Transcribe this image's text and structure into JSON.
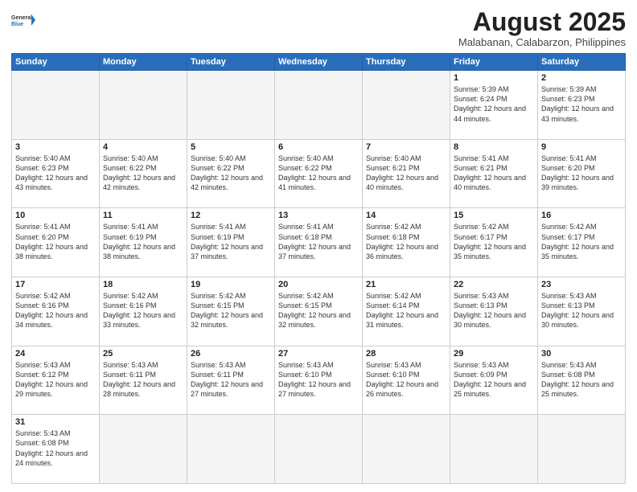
{
  "header": {
    "logo_general": "General",
    "logo_blue": "Blue",
    "title": "August 2025",
    "subtitle": "Malabanan, Calabarzon, Philippines"
  },
  "weekdays": [
    "Sunday",
    "Monday",
    "Tuesday",
    "Wednesday",
    "Thursday",
    "Friday",
    "Saturday"
  ],
  "weeks": [
    [
      {
        "day": "",
        "info": ""
      },
      {
        "day": "",
        "info": ""
      },
      {
        "day": "",
        "info": ""
      },
      {
        "day": "",
        "info": ""
      },
      {
        "day": "",
        "info": ""
      },
      {
        "day": "1",
        "info": "Sunrise: 5:39 AM\nSunset: 6:24 PM\nDaylight: 12 hours\nand 44 minutes."
      },
      {
        "day": "2",
        "info": "Sunrise: 5:39 AM\nSunset: 6:23 PM\nDaylight: 12 hours\nand 43 minutes."
      }
    ],
    [
      {
        "day": "3",
        "info": "Sunrise: 5:40 AM\nSunset: 6:23 PM\nDaylight: 12 hours\nand 43 minutes."
      },
      {
        "day": "4",
        "info": "Sunrise: 5:40 AM\nSunset: 6:22 PM\nDaylight: 12 hours\nand 42 minutes."
      },
      {
        "day": "5",
        "info": "Sunrise: 5:40 AM\nSunset: 6:22 PM\nDaylight: 12 hours\nand 42 minutes."
      },
      {
        "day": "6",
        "info": "Sunrise: 5:40 AM\nSunset: 6:22 PM\nDaylight: 12 hours\nand 41 minutes."
      },
      {
        "day": "7",
        "info": "Sunrise: 5:40 AM\nSunset: 6:21 PM\nDaylight: 12 hours\nand 40 minutes."
      },
      {
        "day": "8",
        "info": "Sunrise: 5:41 AM\nSunset: 6:21 PM\nDaylight: 12 hours\nand 40 minutes."
      },
      {
        "day": "9",
        "info": "Sunrise: 5:41 AM\nSunset: 6:20 PM\nDaylight: 12 hours\nand 39 minutes."
      }
    ],
    [
      {
        "day": "10",
        "info": "Sunrise: 5:41 AM\nSunset: 6:20 PM\nDaylight: 12 hours\nand 38 minutes."
      },
      {
        "day": "11",
        "info": "Sunrise: 5:41 AM\nSunset: 6:19 PM\nDaylight: 12 hours\nand 38 minutes."
      },
      {
        "day": "12",
        "info": "Sunrise: 5:41 AM\nSunset: 6:19 PM\nDaylight: 12 hours\nand 37 minutes."
      },
      {
        "day": "13",
        "info": "Sunrise: 5:41 AM\nSunset: 6:18 PM\nDaylight: 12 hours\nand 37 minutes."
      },
      {
        "day": "14",
        "info": "Sunrise: 5:42 AM\nSunset: 6:18 PM\nDaylight: 12 hours\nand 36 minutes."
      },
      {
        "day": "15",
        "info": "Sunrise: 5:42 AM\nSunset: 6:17 PM\nDaylight: 12 hours\nand 35 minutes."
      },
      {
        "day": "16",
        "info": "Sunrise: 5:42 AM\nSunset: 6:17 PM\nDaylight: 12 hours\nand 35 minutes."
      }
    ],
    [
      {
        "day": "17",
        "info": "Sunrise: 5:42 AM\nSunset: 6:16 PM\nDaylight: 12 hours\nand 34 minutes."
      },
      {
        "day": "18",
        "info": "Sunrise: 5:42 AM\nSunset: 6:16 PM\nDaylight: 12 hours\nand 33 minutes."
      },
      {
        "day": "19",
        "info": "Sunrise: 5:42 AM\nSunset: 6:15 PM\nDaylight: 12 hours\nand 32 minutes."
      },
      {
        "day": "20",
        "info": "Sunrise: 5:42 AM\nSunset: 6:15 PM\nDaylight: 12 hours\nand 32 minutes."
      },
      {
        "day": "21",
        "info": "Sunrise: 5:42 AM\nSunset: 6:14 PM\nDaylight: 12 hours\nand 31 minutes."
      },
      {
        "day": "22",
        "info": "Sunrise: 5:43 AM\nSunset: 6:13 PM\nDaylight: 12 hours\nand 30 minutes."
      },
      {
        "day": "23",
        "info": "Sunrise: 5:43 AM\nSunset: 6:13 PM\nDaylight: 12 hours\nand 30 minutes."
      }
    ],
    [
      {
        "day": "24",
        "info": "Sunrise: 5:43 AM\nSunset: 6:12 PM\nDaylight: 12 hours\nand 29 minutes."
      },
      {
        "day": "25",
        "info": "Sunrise: 5:43 AM\nSunset: 6:11 PM\nDaylight: 12 hours\nand 28 minutes."
      },
      {
        "day": "26",
        "info": "Sunrise: 5:43 AM\nSunset: 6:11 PM\nDaylight: 12 hours\nand 27 minutes."
      },
      {
        "day": "27",
        "info": "Sunrise: 5:43 AM\nSunset: 6:10 PM\nDaylight: 12 hours\nand 27 minutes."
      },
      {
        "day": "28",
        "info": "Sunrise: 5:43 AM\nSunset: 6:10 PM\nDaylight: 12 hours\nand 26 minutes."
      },
      {
        "day": "29",
        "info": "Sunrise: 5:43 AM\nSunset: 6:09 PM\nDaylight: 12 hours\nand 25 minutes."
      },
      {
        "day": "30",
        "info": "Sunrise: 5:43 AM\nSunset: 6:08 PM\nDaylight: 12 hours\nand 25 minutes."
      }
    ],
    [
      {
        "day": "31",
        "info": "Sunrise: 5:43 AM\nSunset: 6:08 PM\nDaylight: 12 hours\nand 24 minutes."
      },
      {
        "day": "",
        "info": ""
      },
      {
        "day": "",
        "info": ""
      },
      {
        "day": "",
        "info": ""
      },
      {
        "day": "",
        "info": ""
      },
      {
        "day": "",
        "info": ""
      },
      {
        "day": "",
        "info": ""
      }
    ]
  ]
}
